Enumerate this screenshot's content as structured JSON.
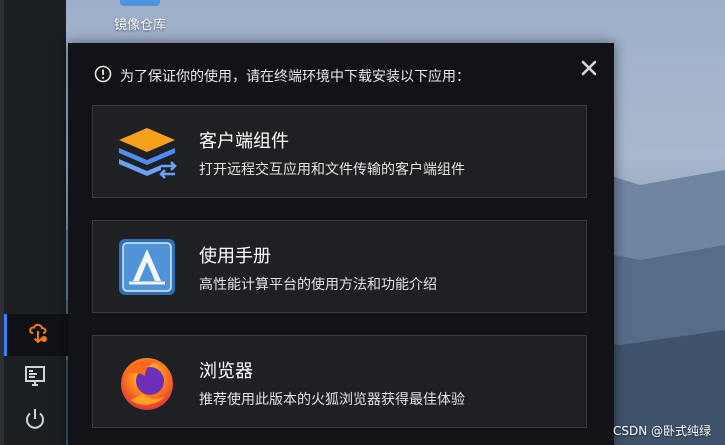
{
  "desktop": {
    "icon_label": "镜像仓库"
  },
  "taskbar": {
    "items": [
      {
        "icon": "upload-cloud-icon",
        "active": true
      },
      {
        "icon": "monitor-icon",
        "active": false
      },
      {
        "icon": "power-icon",
        "active": false
      }
    ]
  },
  "dialog": {
    "notice": "为了保证你的使用，请在终端环境中下载安装以下应用：",
    "cards": [
      {
        "title": "客户端组件",
        "description": "打开远程交互应用和文件传输的客户端组件",
        "icon": "layers-icon"
      },
      {
        "title": "使用手册",
        "description": "高性能计算平台的使用方法和功能介绍",
        "icon": "manual-icon"
      },
      {
        "title": "浏览器",
        "description": "推荐使用此版本的火狐浏览器获得最佳体验",
        "icon": "firefox-icon"
      }
    ]
  },
  "watermark": "CSDN @卧式纯绿",
  "colors": {
    "accent": "#3b82f6",
    "taskbar_active_icon": "#f07a1a"
  }
}
